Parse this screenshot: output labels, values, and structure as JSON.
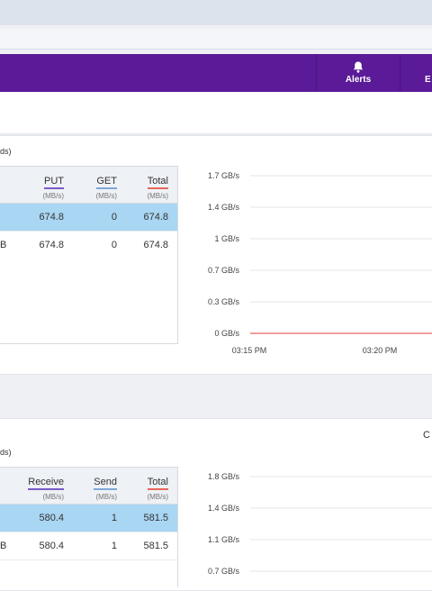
{
  "nav": {
    "alerts_label": "Alerts",
    "next_label": "E"
  },
  "throughput": {
    "caption": "ds)",
    "columns": [
      {
        "name": "PUT",
        "unit": "(MB/s)",
        "underline": "#7b5ac8"
      },
      {
        "name": "GET",
        "unit": "(MB/s)",
        "underline": "#7fa8d8"
      },
      {
        "name": "Total",
        "unit": "(MB/s)",
        "underline": "#e8665c"
      }
    ],
    "rows": [
      {
        "first": "",
        "values": [
          "674.8",
          "0",
          "674.8"
        ],
        "selected": true
      },
      {
        "first": "B",
        "values": [
          "674.8",
          "0",
          "674.8"
        ],
        "selected": false
      }
    ],
    "chart_data": {
      "type": "line",
      "y_ticks": [
        "1.7 GB/s",
        "1.4 GB/s",
        "1 GB/s",
        "0.7 GB/s",
        "0.3 GB/s",
        "0 GB/s"
      ],
      "x_ticks": [
        "03:15 PM",
        "03:20 PM"
      ],
      "series": [
        {
          "color": "#e8665c",
          "values": [
            0,
            0,
            0
          ]
        }
      ]
    }
  },
  "network": {
    "corner_label": "C",
    "caption": "ds)",
    "columns": [
      {
        "name": "Receive",
        "unit": "(MB/s)",
        "underline": "#7b5ac8"
      },
      {
        "name": "Send",
        "unit": "(MB/s)",
        "underline": "#7fa8d8"
      },
      {
        "name": "Total",
        "unit": "(MB/s)",
        "underline": "#e8665c"
      }
    ],
    "rows": [
      {
        "first": "",
        "values": [
          "580.4",
          "1",
          "581.5"
        ],
        "selected": true
      },
      {
        "first": "B",
        "values": [
          "580.4",
          "1",
          "581.5"
        ],
        "selected": false
      }
    ],
    "chart_data": {
      "type": "line",
      "y_ticks": [
        "1.8 GB/s",
        "1.4 GB/s",
        "1.1 GB/s",
        "0.7 GB/s"
      ],
      "x_ticks": []
    }
  }
}
